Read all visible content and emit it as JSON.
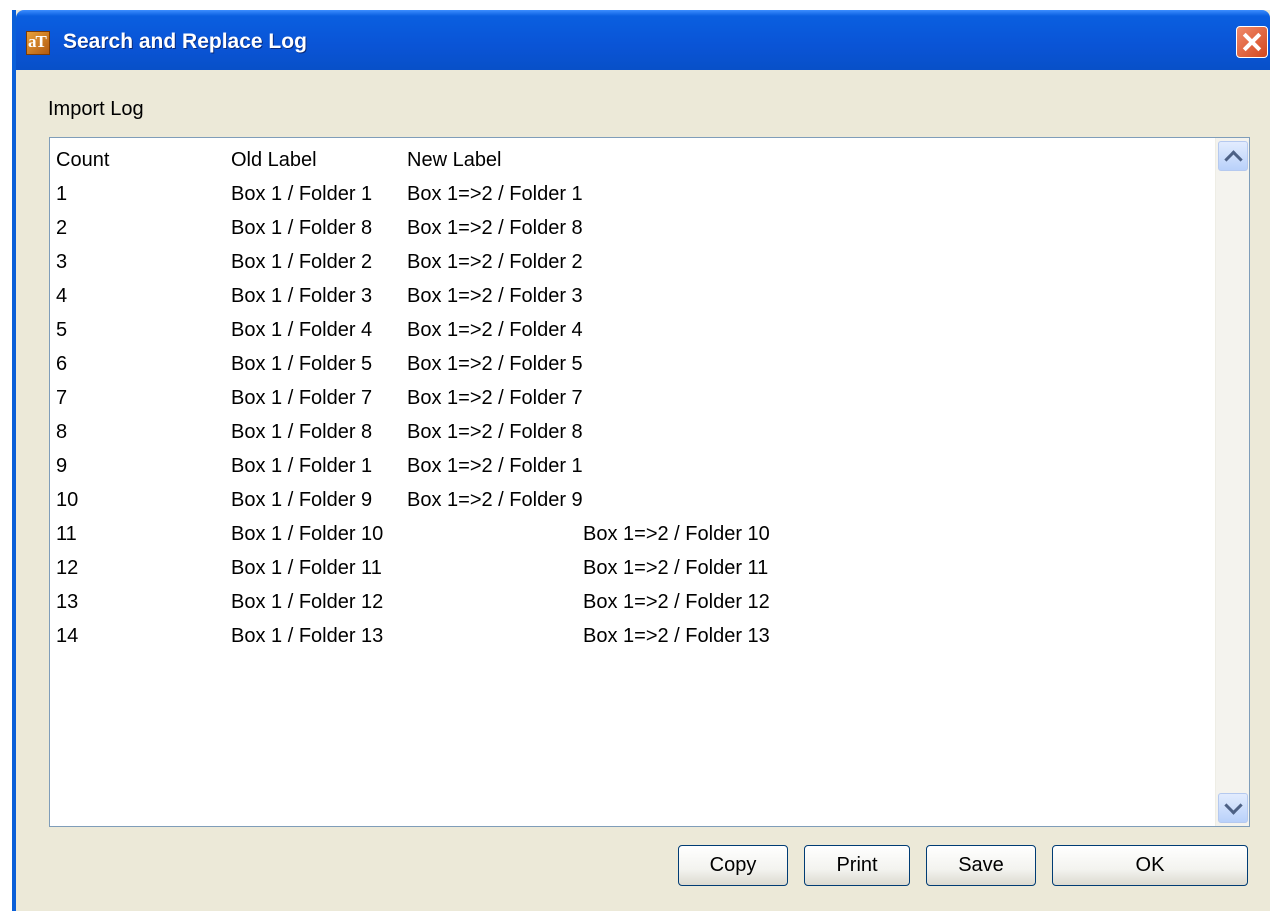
{
  "window": {
    "title": "Search and Replace Log",
    "icon_text": "aT",
    "close_icon": "close-icon"
  },
  "section_label": "Import Log",
  "log": {
    "headers": [
      "Count",
      "Old Label",
      "New Label"
    ],
    "rows": [
      {
        "count": "1",
        "old": "Box 1 / Folder 1",
        "new": "Box 1=>2 / Folder 1"
      },
      {
        "count": "2",
        "old": "Box 1 / Folder 8",
        "new": "Box 1=>2 / Folder 8"
      },
      {
        "count": "3",
        "old": "Box 1 / Folder 2",
        "new": "Box 1=>2 / Folder 2"
      },
      {
        "count": "4",
        "old": "Box 1 / Folder 3",
        "new": "Box 1=>2 / Folder 3"
      },
      {
        "count": "5",
        "old": "Box 1 / Folder 4",
        "new": "Box 1=>2 / Folder 4"
      },
      {
        "count": "6",
        "old": "Box 1 / Folder 5",
        "new": "Box 1=>2 / Folder 5"
      },
      {
        "count": "7",
        "old": "Box 1 / Folder 7",
        "new": "Box 1=>2 / Folder 7"
      },
      {
        "count": "8",
        "old": "Box 1 / Folder 8",
        "new": "Box 1=>2 / Folder 8"
      },
      {
        "count": "9",
        "old": "Box 1 / Folder 1",
        "new": "Box 1=>2 / Folder 1"
      },
      {
        "count": "10",
        "old": "Box 1 / Folder 9",
        "new": "Box 1=>2 / Folder 9"
      },
      {
        "count": "11",
        "old": "Box 1 / Folder 10",
        "new": "Box 1=>2 / Folder 10"
      },
      {
        "count": "12",
        "old": "Box 1 / Folder 11",
        "new": "Box 1=>2 / Folder 11"
      },
      {
        "count": "13",
        "old": "Box 1 / Folder 12",
        "new": "Box 1=>2 / Folder 12"
      },
      {
        "count": "14",
        "old": "Box 1 / Folder 13",
        "new": "Box 1=>2 / Folder 13"
      }
    ]
  },
  "buttons": {
    "copy": "Copy",
    "print": "Print",
    "save": "Save",
    "ok": "OK"
  },
  "colors": {
    "titlebar": "#0a54d6",
    "window_bg": "#ece9d8",
    "close_button": "#d4471e"
  }
}
